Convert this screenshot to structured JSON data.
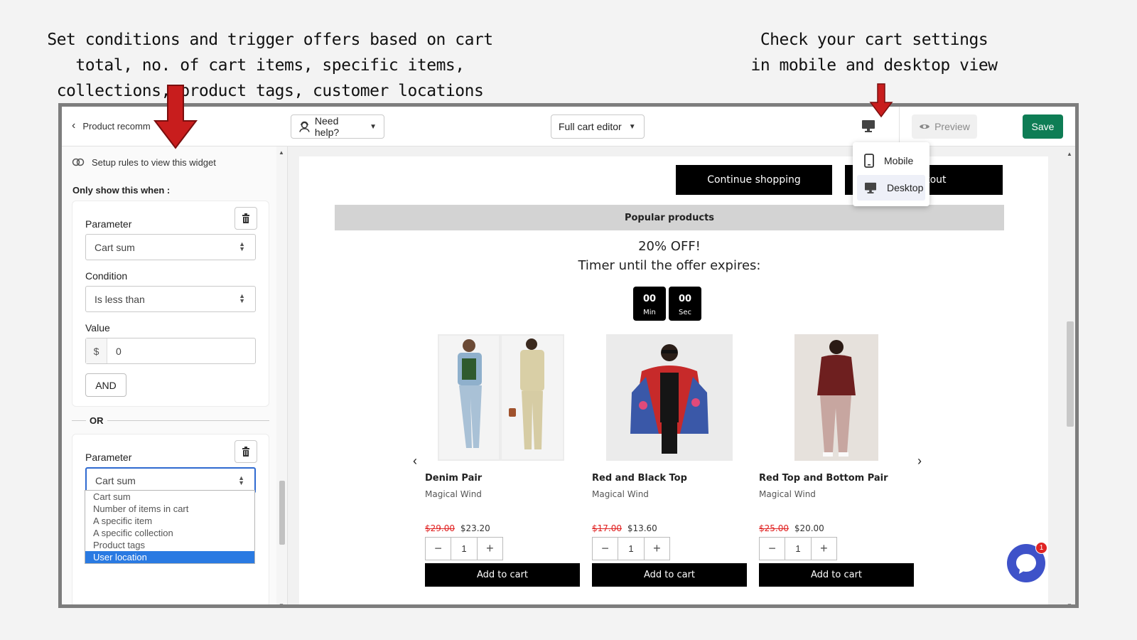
{
  "captions": {
    "left": "Set conditions and trigger offers based on cart total, no. of cart items, specific items, collections, product tags, customer locations",
    "right": "Check your cart settings in mobile and desktop view"
  },
  "colors": {
    "arrow_red": "#c81d1d",
    "save_green": "#0e7d55",
    "chat_blue": "#3e52c9",
    "price_old_red": "#e02020",
    "selected_option_blue": "#2a7ae2"
  },
  "topbar": {
    "back_label": "Product recomm",
    "need_help_label": "Need help?",
    "editor_label": "Full cart editor",
    "preview_label": "Preview",
    "save_label": "Save"
  },
  "device_menu": {
    "items": [
      {
        "label": "Mobile",
        "icon": "mobile-phone-icon"
      },
      {
        "label": "Desktop",
        "icon": "desktop-monitor-icon"
      }
    ],
    "selected": "Desktop"
  },
  "sidebar": {
    "rules_link": "Setup rules to view this widget",
    "only_show": "Only show this when :",
    "rule1": {
      "parameter_label": "Parameter",
      "parameter_value": "Cart sum",
      "condition_label": "Condition",
      "condition_value": "Is less than",
      "value_label": "Value",
      "value_prefix": "$",
      "value": "0",
      "and_label": "AND"
    },
    "or_label": "OR",
    "rule2": {
      "parameter_label": "Parameter",
      "parameter_value": "Cart sum",
      "options": [
        "Cart sum",
        "Number of items in cart",
        "A specific item",
        "A specific collection",
        "Product tags",
        "User location"
      ],
      "highlighted_option": "User location"
    }
  },
  "preview": {
    "continue_label": "Continue shopping",
    "checkout_label": "kout",
    "popular_label": "Popular products",
    "offer_line1": "20% OFF!",
    "offer_line2": "Timer until the offer expires:",
    "timer": [
      {
        "value": "00",
        "unit": "Min"
      },
      {
        "value": "00",
        "unit": "Sec"
      }
    ],
    "prev_arrow": "‹",
    "next_arrow": "›",
    "products": [
      {
        "name": "Denim Pair",
        "vendor": "Magical Wind",
        "old_price": "$29.00",
        "new_price": "$23.20",
        "qty": "1",
        "add_label": "Add to cart"
      },
      {
        "name": "Red and Black Top",
        "vendor": "Magical Wind",
        "old_price": "$17.00",
        "new_price": "$13.60",
        "qty": "1",
        "add_label": "Add to cart"
      },
      {
        "name": "Red Top and Bottom Pair",
        "vendor": "Magical Wind",
        "old_price": "$25.00",
        "new_price": "$20.00",
        "qty": "1",
        "add_label": "Add to cart"
      }
    ],
    "chat_badge": "1"
  }
}
